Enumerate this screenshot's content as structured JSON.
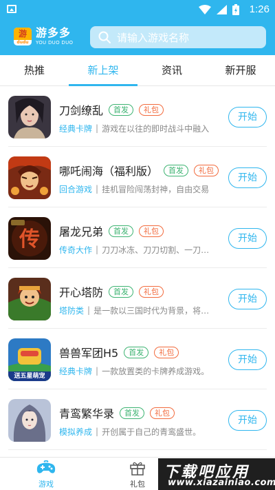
{
  "status_bar": {
    "time": "1:26"
  },
  "header": {
    "logo_char": "游",
    "logo_small": "dudu",
    "brand_name": "游多多",
    "brand_subtitle": "YOU DUO DUO",
    "search_placeholder": "请输入游戏名称"
  },
  "tabs": [
    {
      "label": "热推"
    },
    {
      "label": "新上架"
    },
    {
      "label": "资讯"
    },
    {
      "label": "新开服"
    }
  ],
  "games": [
    {
      "title": "刀剑缭乱",
      "tag_first": "首发",
      "tag_gift": "礼包",
      "category": "经典卡牌",
      "desc": "游戏在以往的即时战斗中融入",
      "button": "开始",
      "icon_color": "#3a3540",
      "icon_accent": "#d9b8a8"
    },
    {
      "title": "哪吒闹海（福利版）",
      "tag_first": "首发",
      "tag_gift": "礼包",
      "category": "回合游戏",
      "desc": "挂机冒险闯荡封神，自由交易",
      "button": "开始",
      "icon_color": "#7a2a14",
      "icon_accent": "#f0a23a"
    },
    {
      "title": "屠龙兄弟",
      "tag_first": "首发",
      "tag_gift": "礼包",
      "category": "传奇大作",
      "desc": "刀刀冰冻、刀刀切割、一刀秒杀",
      "button": "开始",
      "icon_color": "#2a1208",
      "icon_accent": "#e0542a"
    },
    {
      "title": "开心塔防",
      "tag_first": "首发",
      "tag_gift": "礼包",
      "category": "塔防类",
      "desc": "是一款以三国时代为背景，将策略",
      "button": "开始",
      "icon_color": "#5a2e1c",
      "icon_accent": "#e8a43c"
    },
    {
      "title": "兽兽军团H5",
      "tag_first": "首发",
      "tag_gift": "礼包",
      "category": "经典卡牌",
      "desc": "一款放置类的卡牌养成游戏。",
      "button": "开始",
      "icon_color": "#2d7ac4",
      "icon_accent": "#f2c23a",
      "icon_text": "送五星萌宠"
    },
    {
      "title": "青鸾繁华录",
      "tag_first": "首发",
      "tag_gift": "礼包",
      "category": "模拟养成",
      "desc": "开创属于自己的青鸾盛世。",
      "button": "开始",
      "icon_color": "#b9c3d8",
      "icon_accent": "#6a6f8a"
    }
  ],
  "bottom_nav": [
    {
      "label": "游戏",
      "icon": "gamepad-icon"
    },
    {
      "label": "礼包",
      "icon": "gift-icon"
    }
  ],
  "watermark": {
    "cn": "下载吧应用",
    "en": "www.xiazainiao.com"
  },
  "colors": {
    "brand": "#2fb6ee",
    "tag_first": "#3cb371",
    "tag_gift": "#f26a3c"
  }
}
